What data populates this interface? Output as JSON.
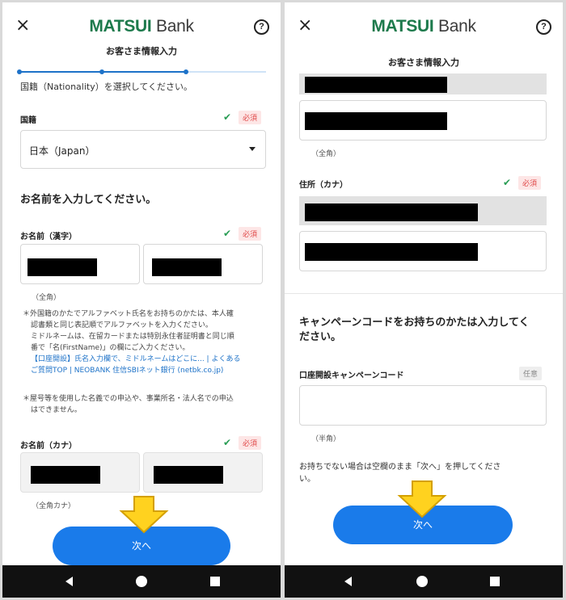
{
  "app": {
    "logo_main": "MATSUI",
    "logo_bank": "Bank",
    "screen_title": "お客さま情報入力",
    "close_glyph": "×",
    "help_glyph": "?",
    "brand_color": "#1d7a4c",
    "accent_color": "#1a7bea"
  },
  "left": {
    "progress": {
      "steps": 4,
      "current_step": 3
    },
    "nationality_prompt": "国籍（Nationality）を選択してください。",
    "nationality": {
      "label": "国籍",
      "required": "必須",
      "value": "日本（Japan）"
    },
    "name_heading": "お名前を入力してください。",
    "name_kanji": {
      "label": "お名前（漢字）",
      "required": "必須",
      "hint": "（全角）"
    },
    "notes": {
      "note1_line1": "外国籍のかたでアルファベット氏名をお持ちのかたは、本人確",
      "note1_line2": "認書類と同じ表記順でアルファベットを入力ください。",
      "note1_line3": "ミドルネームは、在留カードまたは特別永住者証明書と同じ順",
      "note1_line4": "番で「名(FirstName)」の欄にご入力ください。",
      "link_line1": "【口座開設】氏名入力欄で、ミドルネームはどこに... | よくある",
      "link_line2": "ご質問TOP | NEOBANK 住信SBIネット銀行 (netbk.co.jp)",
      "note2_line1": "屋号等を使用した名義での申込や、事業所名・法人名での申込",
      "note2_line2": "はできません。"
    },
    "name_kana": {
      "label": "お名前（カナ）",
      "required": "必須",
      "hint": "（全角カナ）"
    },
    "next_button": "次へ"
  },
  "right": {
    "address_hint": "（全角）",
    "address_kana": {
      "label": "住所（カナ）",
      "required": "必須"
    },
    "campaign_heading_line1": "キャンペーンコードをお持ちのかたは入力してく",
    "campaign_heading_line2": "ださい。",
    "campaign": {
      "label": "口座開設キャンペーンコード",
      "optional": "任意",
      "hint": "（半角）"
    },
    "blank_note_line1": "お持ちでない場合は空欄のまま「次へ」を押してくださ",
    "blank_note_line2": "い。",
    "next_button": "次へ"
  },
  "icons": {
    "close": "close-icon",
    "help": "help-icon",
    "check": "check-icon",
    "dropdown": "caret-down-icon",
    "arrow": "down-arrow-annotation-icon",
    "nav_back": "back-icon",
    "nav_home": "home-icon",
    "nav_recent": "recents-icon"
  }
}
